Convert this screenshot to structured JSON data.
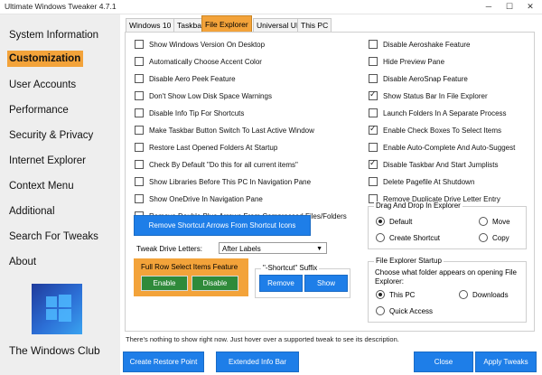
{
  "window": {
    "title": "Ultimate Windows Tweaker 4.7.1",
    "minimize": "─",
    "maximize": "☐",
    "close": "✕"
  },
  "sidebar": {
    "items": [
      {
        "label": "System Information"
      },
      {
        "label": "Customization"
      },
      {
        "label": "User Accounts"
      },
      {
        "label": "Performance"
      },
      {
        "label": "Security & Privacy"
      },
      {
        "label": "Internet Explorer"
      },
      {
        "label": "Context Menu"
      },
      {
        "label": "Additional"
      },
      {
        "label": "Search For Tweaks"
      },
      {
        "label": "About"
      }
    ],
    "active_index": 1,
    "brand": "The Windows Club"
  },
  "tabs": [
    {
      "label": "Windows 10"
    },
    {
      "label": "Taskbar"
    },
    {
      "label": "File Explorer"
    },
    {
      "label": "Universal UI"
    },
    {
      "label": "This PC"
    }
  ],
  "left_checks": [
    {
      "label": "Show Windows Version On Desktop",
      "checked": false
    },
    {
      "label": "Automatically Choose Accent Color",
      "checked": false
    },
    {
      "label": "Disable Aero Peek Feature",
      "checked": false
    },
    {
      "label": "Don't Show Low Disk Space Warnings",
      "checked": false
    },
    {
      "label": "Disable Info Tip For Shortcuts",
      "checked": false
    },
    {
      "label": "Make Taskbar Button Switch To Last Active Window",
      "checked": false
    },
    {
      "label": "Restore Last Opened Folders At Startup",
      "checked": false
    },
    {
      "label": "Check By Default \"Do this for all current items\"",
      "checked": false
    },
    {
      "label": "Show Libraries Before This PC In Navigation Pane",
      "checked": false
    },
    {
      "label": "Show OneDrive In Navigation Pane",
      "checked": false
    },
    {
      "label": "Remove Double Blue Arrows From Compressed Files/Folders",
      "checked": false
    }
  ],
  "right_checks": [
    {
      "label": "Disable Aeroshake Feature",
      "checked": false
    },
    {
      "label": "Hide Preview Pane",
      "checked": false
    },
    {
      "label": "Disable AeroSnap Feature",
      "checked": false
    },
    {
      "label": "Show Status Bar In File Explorer",
      "checked": true
    },
    {
      "label": "Launch Folders In A Separate Process",
      "checked": false
    },
    {
      "label": "Enable Check Boxes To Select Items",
      "checked": true
    },
    {
      "label": "Enable Auto-Complete And Auto-Suggest",
      "checked": false
    },
    {
      "label": "Disable Taskbar And Start Jumplists",
      "checked": true
    },
    {
      "label": "Delete Pagefile At Shutdown",
      "checked": false
    },
    {
      "label": "Remove Duplicate Drive Letter Entry",
      "checked": false
    }
  ],
  "remove_arrows_button": "Remove Shortcut Arrows From Shortcut Icons",
  "drive_letters": {
    "label": "Tweak Drive Letters:",
    "selected": "After Labels"
  },
  "full_row": {
    "label": "Full Row Select Items Feature",
    "enable": "Enable",
    "disable": "Disable"
  },
  "shortcut_suffix": {
    "label": "\"-Shortcut\" Suffix",
    "remove": "Remove",
    "show": "Show"
  },
  "drag_drop": {
    "title": "Drag And Drop In Explorer",
    "options": [
      "Default",
      "Move",
      "Create Shortcut",
      "Copy"
    ],
    "selected": "Default"
  },
  "explorer_startup": {
    "title": "File Explorer Startup",
    "description": "Choose what folder appears on opening File Explorer:",
    "options": [
      "This PC",
      "Downloads",
      "Quick Access"
    ],
    "selected": "This PC"
  },
  "status_text": "There's nothing to show right now. Just hover over a supported tweak to see its description.",
  "bottom_buttons": {
    "restore_point": "Create Restore Point",
    "extended_info": "Extended Info Bar",
    "close": "Close",
    "apply": "Apply Tweaks"
  },
  "colors": {
    "accent_orange": "#f3a33a",
    "blue_button": "#1e7ee8",
    "green_button": "#2f8a3a"
  }
}
